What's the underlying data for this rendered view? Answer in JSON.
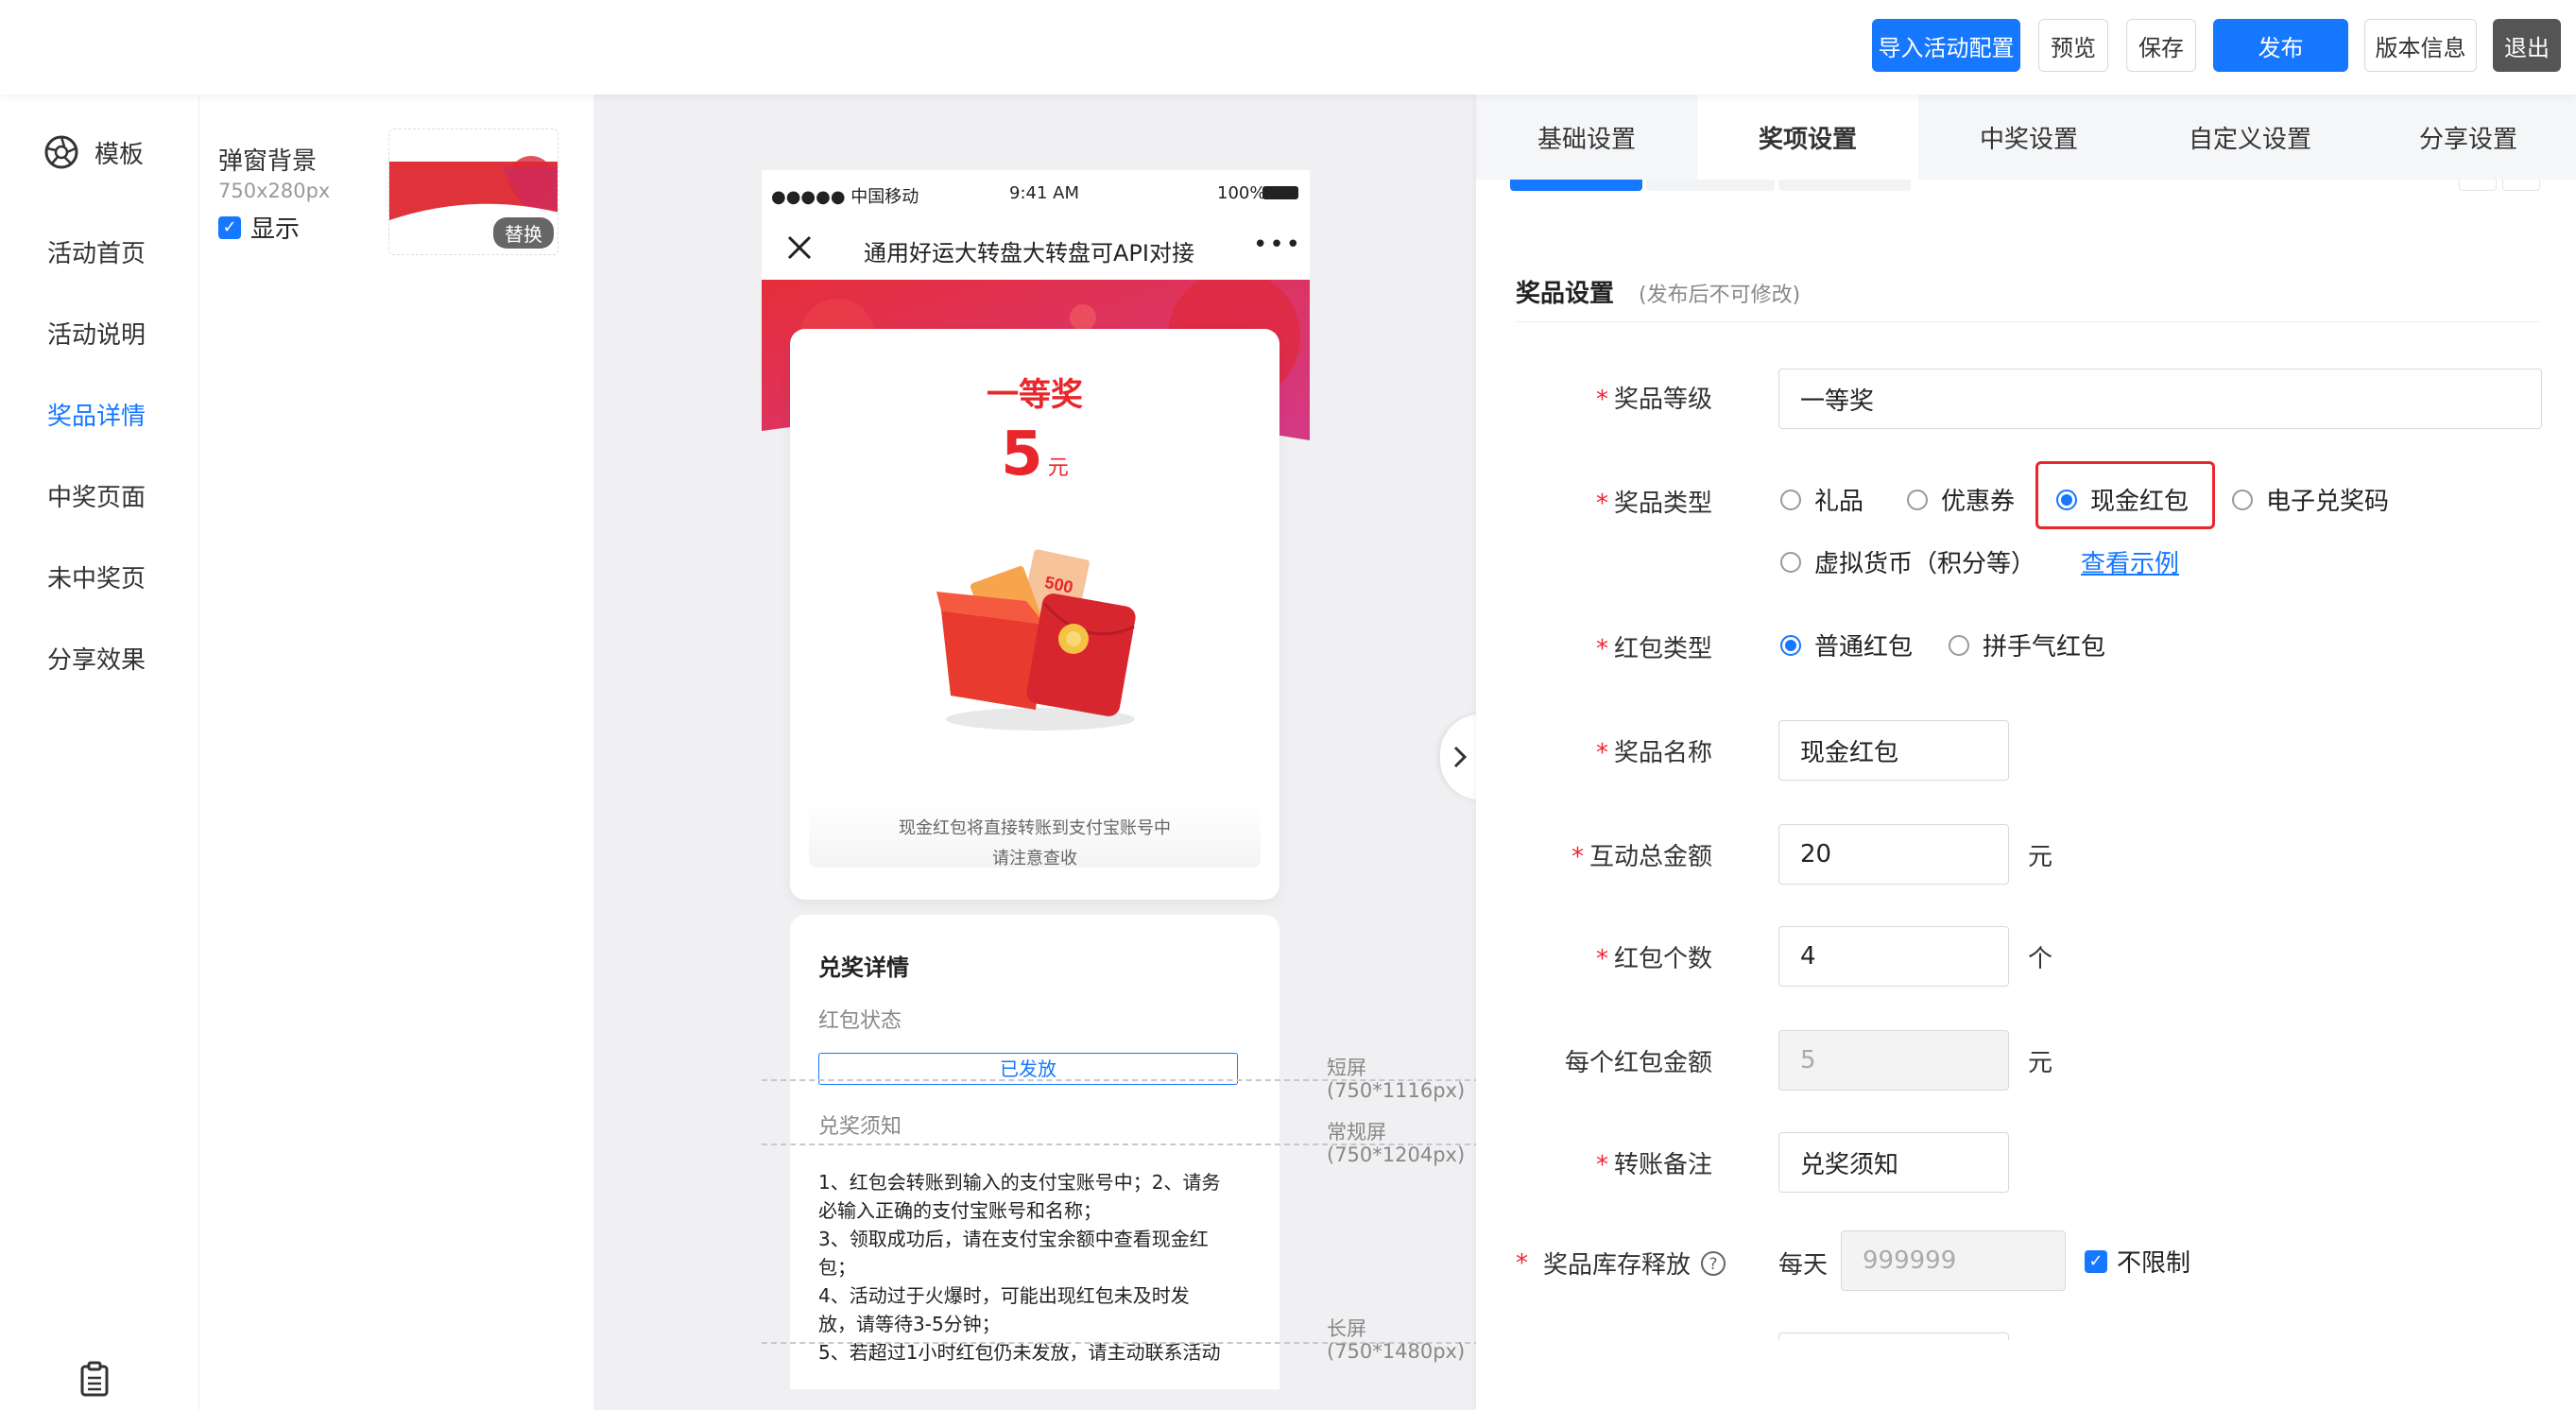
{
  "toolbar": {
    "import_label": "导入活动配置",
    "preview_label": "预览",
    "save_label": "保存",
    "publish_label": "发布",
    "version_label": "版本信息",
    "exit_label": "退出"
  },
  "nav": {
    "header": "模板",
    "items": [
      {
        "label": "活动首页",
        "active": false
      },
      {
        "label": "活动说明",
        "active": false
      },
      {
        "label": "奖品详情",
        "active": true
      },
      {
        "label": "中奖页面",
        "active": false
      },
      {
        "label": "未中奖页",
        "active": false
      },
      {
        "label": "分享效果",
        "active": false
      }
    ]
  },
  "popup_bg": {
    "title": "弹窗背景",
    "size": "750x280px",
    "show_label": "显示",
    "replace_label": "替换"
  },
  "phone": {
    "carrier": "●●●●● 中国移动",
    "time": "9:41 AM",
    "battery": "100%",
    "title": "通用好运大转盘大转盘可API对接",
    "prize_level": "一等奖",
    "prize_amount": "5",
    "prize_unit": "元",
    "tip_line1": "现金红包将直接转账到支付宝账号中",
    "tip_line2": "请注意查收",
    "detail_title": "兑奖详情",
    "status_label": "红包状态",
    "status_value": "已发放",
    "notice_label": "兑奖须知",
    "notice_lines": [
      "1、红包会转账到输入的支付宝账号中；2、请务",
      "必输入正确的支付宝账号和名称；",
      "3、领取成功后，请在支付宝余额中查看现金红",
      "包；",
      "4、活动过于火爆时，可能出现红包未及时发",
      "放，请等待3-5分钟；",
      "5、若超过1小时红包仍未发放，请主动联系活动"
    ],
    "card_price": "500"
  },
  "screen_labels": {
    "short_title": "短屏",
    "short_size": "(750*1116px)",
    "normal_title": "常规屏",
    "normal_size": "(750*1204px)",
    "long_title": "长屏",
    "long_size": "(750*1480px)"
  },
  "tabs": [
    {
      "label": "基础设置",
      "active": false
    },
    {
      "label": "奖项设置",
      "active": true
    },
    {
      "label": "中奖设置",
      "active": false
    },
    {
      "label": "自定义设置",
      "active": false
    },
    {
      "label": "分享设置",
      "active": false
    }
  ],
  "form": {
    "section_title": "奖品设置",
    "section_note": "(发布后不可修改)",
    "level_label": "奖品等级",
    "level_value": "一等奖",
    "type_label": "奖品类型",
    "type_options": [
      "礼品",
      "优惠券",
      "现金红包",
      "电子兑奖码",
      "虚拟货币（积分等）"
    ],
    "type_selected": "现金红包",
    "example_link": "查看示例",
    "packet_type_label": "红包类型",
    "packet_type_options": [
      "普通红包",
      "拼手气红包"
    ],
    "packet_type_selected": "普通红包",
    "name_label": "奖品名称",
    "name_value": "现金红包",
    "total_label": "互动总金额",
    "total_value": "20",
    "total_unit": "元",
    "count_label": "红包个数",
    "count_value": "4",
    "count_unit": "个",
    "each_label": "每个红包金额",
    "each_value": "5",
    "each_unit": "元",
    "remark_label": "转账备注",
    "remark_value": "兑奖须知",
    "stock_label": "奖品库存释放",
    "stock_per_day": "每天",
    "stock_placeholder": "999999",
    "stock_unlimited": "不限制"
  },
  "colors": {
    "primary": "#1677ff",
    "danger": "#f5222d",
    "highlight_box": "#e8262b",
    "banner_red": "#e8303a"
  }
}
